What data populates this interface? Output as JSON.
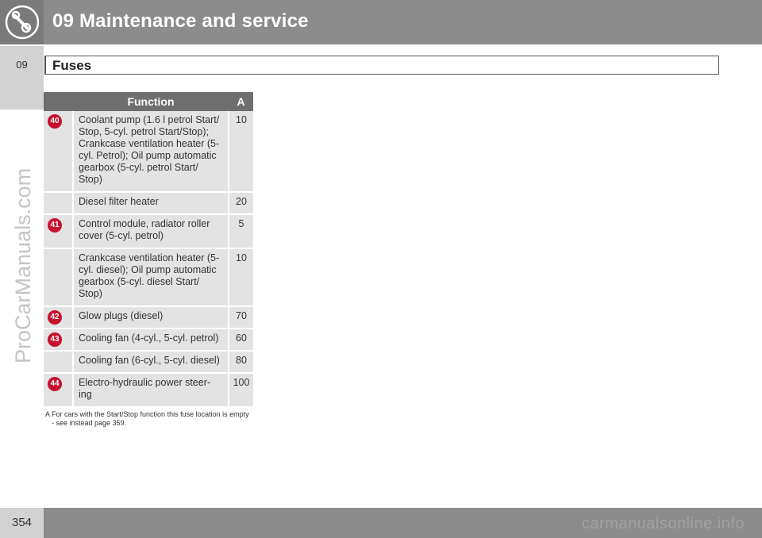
{
  "header": {
    "title": "09 Maintenance and service",
    "icon": "wrench-gear-icon"
  },
  "sidetab": {
    "label": "09"
  },
  "section": {
    "title": "Fuses"
  },
  "watermark": "ProCarManuals.com",
  "table": {
    "headers": {
      "number": "",
      "function": "Function",
      "amperage": "A"
    },
    "rows": [
      {
        "number": "40",
        "function": "Coolant pump (1.6 l petrol Start/ Stop, 5-cyl. petrol Start/Stop); Crankcase ventilation heater (5- cyl. Petrol); Oil pump automatic gearbox (5-cyl. petrol Start/ Stop)",
        "amperage": "10"
      },
      {
        "number": "",
        "function": "Diesel filter heater",
        "amperage": "20"
      },
      {
        "number": "41",
        "function": "Control module, radiator roller cover (5-cyl. petrol)",
        "amperage": "5"
      },
      {
        "number": "",
        "function": "Crankcase ventilation heater (5- cyl. diesel); Oil pump automatic gearbox (5-cyl. diesel Start/ Stop)",
        "amperage": "10"
      },
      {
        "number": "42",
        "function": "Glow plugs (diesel)",
        "amperage": "70"
      },
      {
        "number": "43",
        "function": "Cooling fan (4-cyl., 5-cyl. petrol)",
        "amperage": "60"
      },
      {
        "number": "",
        "function": "Cooling fan (6-cyl., 5-cyl. diesel)",
        "amperage": "80"
      },
      {
        "number": "44",
        "function": "Electro-hydraulic power steer- ing",
        "amperage": "100"
      }
    ]
  },
  "footnote": {
    "marker": "A",
    "text": "For cars with the Start/Stop function this fuse location is empty - see instead page 359."
  },
  "footer": {
    "page_number": "354",
    "watermark": "carmanualsonline.info"
  },
  "colors": {
    "header": "#8c8c8c",
    "table_header": "#6e6e6e",
    "table_cell": "#e3e3e3",
    "badge": "#c8102e"
  }
}
